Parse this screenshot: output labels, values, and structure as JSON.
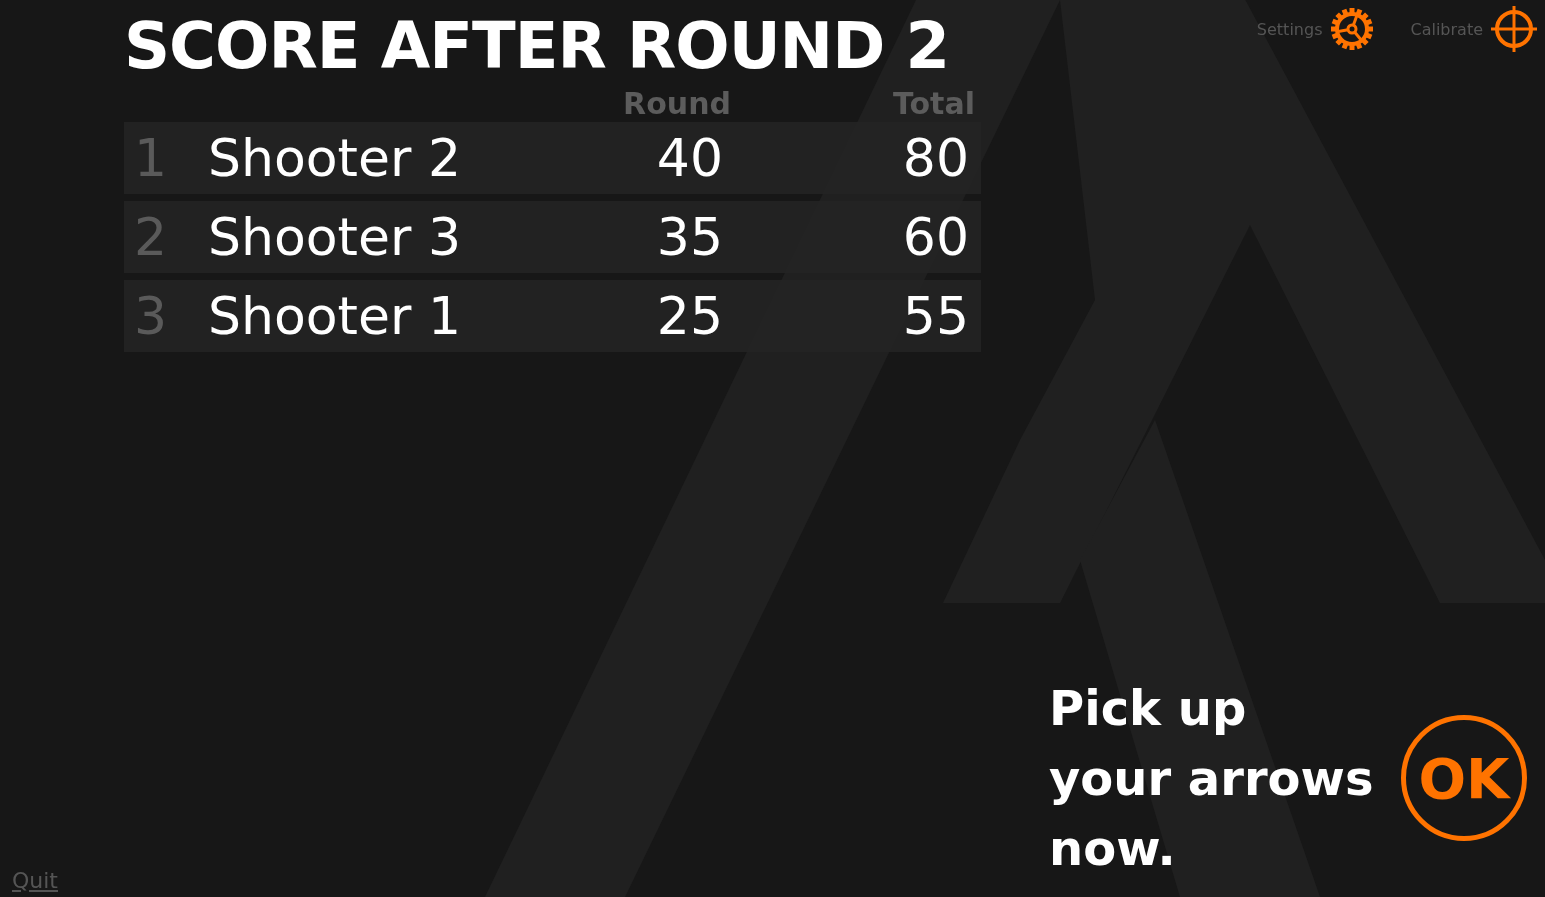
{
  "title": "SCORE AFTER ROUND 2",
  "columns": [
    "Round",
    "Total"
  ],
  "rows": [
    {
      "rank": "1",
      "name": "Shooter 2",
      "round": "40",
      "total": "80"
    },
    {
      "rank": "2",
      "name": "Shooter 3",
      "round": "35",
      "total": "60"
    },
    {
      "rank": "3",
      "name": "Shooter 1",
      "round": "25",
      "total": "55"
    }
  ],
  "top_links": [
    {
      "label": "Settings",
      "kind": "gear"
    },
    {
      "label": "Calibrate",
      "kind": "crosshair"
    }
  ],
  "message": "Pick up your arrows now.",
  "ok_button": "OK",
  "quit_link": "Quit"
}
